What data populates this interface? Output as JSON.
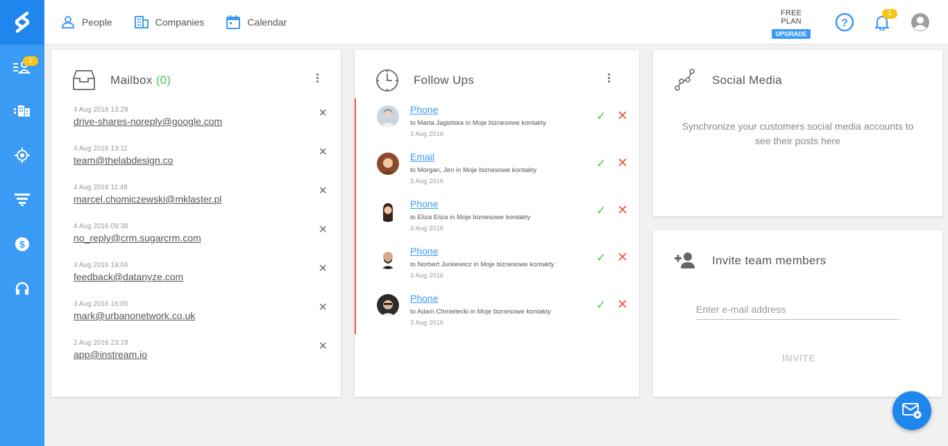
{
  "colors": {
    "accent": "#3a9bf5",
    "accent_dark": "#1f86ee",
    "badge": "#f9c31a",
    "success": "#4cbf66",
    "danger": "#f0574d"
  },
  "sidebar": {
    "items": [
      {
        "icon": "contacts-list-icon",
        "badge": "1"
      },
      {
        "icon": "companies-icon"
      },
      {
        "icon": "target-icon"
      },
      {
        "icon": "funnel-icon"
      },
      {
        "icon": "dollar-icon"
      },
      {
        "icon": "headset-icon"
      }
    ]
  },
  "topnav": {
    "people": "People",
    "companies": "Companies",
    "calendar": "Calendar",
    "plan_label": "FREE PLAN",
    "upgrade": "UPGRADE",
    "notif_count": "1"
  },
  "mailbox": {
    "title": "Mailbox",
    "count": "(0)",
    "items": [
      {
        "date": "4 Aug 2016 13:29",
        "address": "drive-shares-noreply@google.com"
      },
      {
        "date": "4 Aug 2016 13:11",
        "address": "team@thelabdesign.co"
      },
      {
        "date": "4 Aug 2016 11:48",
        "address": "marcel.chomiczewski@mklaster.pl"
      },
      {
        "date": "4 Aug 2016 09:38",
        "address": "no_reply@crm.sugarcrm.com"
      },
      {
        "date": "3 Aug 2016 18:04",
        "address": "feedback@datanyze.com"
      },
      {
        "date": "3 Aug 2016 16:05",
        "address": "mark@urbanonetwork.co.uk"
      },
      {
        "date": "2 Aug 2016 23:19",
        "address": "app@instream.io"
      }
    ]
  },
  "followups": {
    "title": "Follow Ups",
    "items": [
      {
        "type": "Phone",
        "desc": "to Marta Jagielska in Moje biznesowe kontakty",
        "date": "3 Aug 2016"
      },
      {
        "type": "Email",
        "desc": "to Morgan, Jen in Moje biznesowe kontakty",
        "date": "3 Aug 2016"
      },
      {
        "type": "Phone",
        "desc": "to Eliza Eliza in Moje biznesowe kontakty",
        "date": "3 Aug 2016"
      },
      {
        "type": "Phone",
        "desc": "to Norbert Jurkiewicz in Moje biznesowe kontakty",
        "date": "3 Aug 2016"
      },
      {
        "type": "Phone",
        "desc": "to Adam Chmielecki in Moje biznesowe kontakty",
        "date": "3 Aug 2016"
      }
    ]
  },
  "social": {
    "title": "Social Media",
    "text": "Synchronize your customers social media accounts to see their posts here"
  },
  "invite": {
    "title": "Invite team members",
    "placeholder": "Enter e-mail address",
    "button": "INVITE"
  }
}
